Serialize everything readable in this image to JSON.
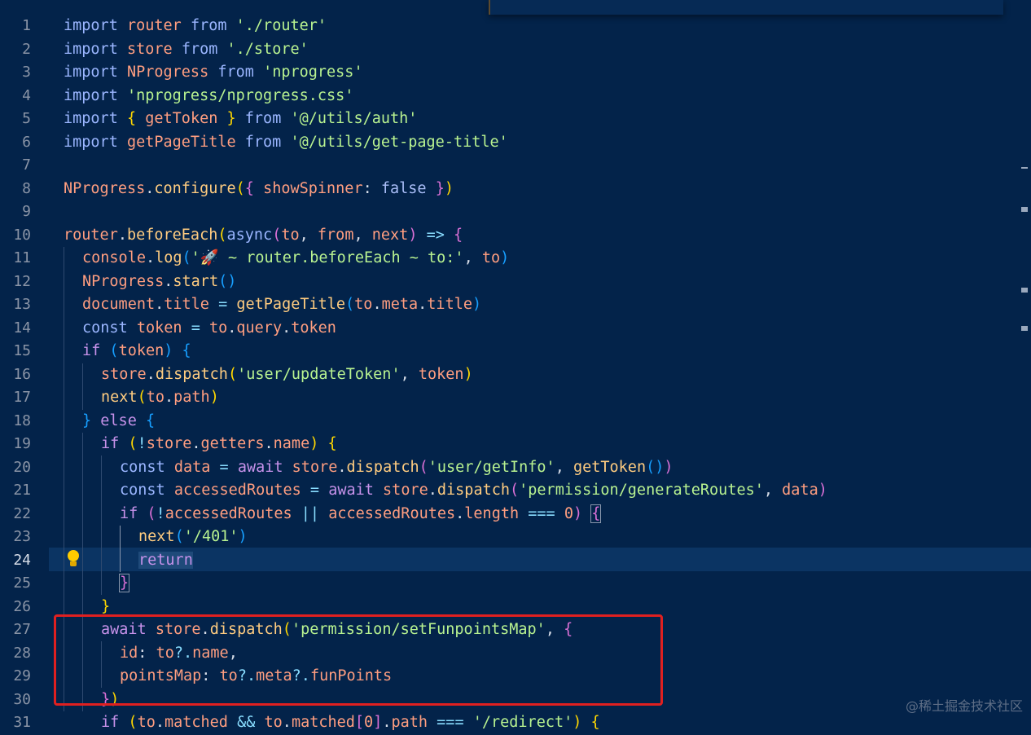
{
  "editor": {
    "active_line": "24",
    "line_numbers": [
      "1",
      "2",
      "3",
      "4",
      "5",
      "6",
      "7",
      "8",
      "9",
      "10",
      "11",
      "12",
      "13",
      "14",
      "15",
      "16",
      "17",
      "18",
      "19",
      "20",
      "21",
      "22",
      "23",
      "24",
      "25",
      "26",
      "27",
      "28",
      "29",
      "30",
      "31"
    ]
  },
  "watermark": "@稀土掘金技术社区",
  "icons": {
    "code_action": "lightbulb-icon"
  },
  "colors": {
    "background": "#03234a",
    "highlight_box": "#e02020",
    "line_highlight": "#0b3463"
  }
}
